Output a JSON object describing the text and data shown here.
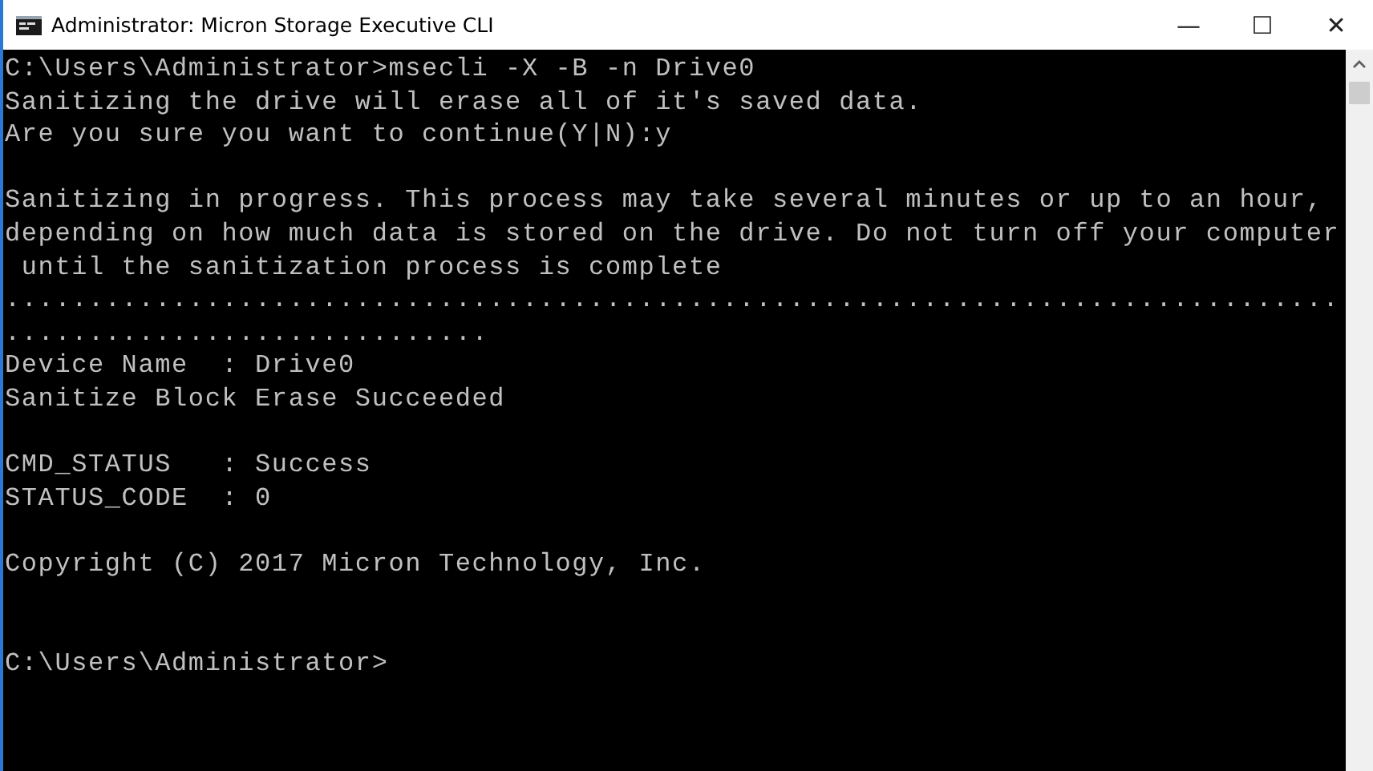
{
  "window": {
    "title": "Administrator: Micron Storage Executive CLI",
    "controls": [
      "—",
      "☐",
      "✕"
    ]
  },
  "console": {
    "lines": [
      {
        "kind": "text",
        "text": "C:\\Users\\Administrator>msecli -X -B -n Drive0"
      },
      {
        "kind": "text",
        "text": "Sanitizing the drive will erase all of it's saved data."
      },
      {
        "kind": "text",
        "text": "Are you sure you want to continue(Y|N):y"
      },
      {
        "kind": "blank"
      },
      {
        "kind": "text",
        "text": "Sanitizing in progress. This process may take several minutes or up to an hour,"
      },
      {
        "kind": "text",
        "text": "depending on how much data is stored on the drive. Do not turn off your computer"
      },
      {
        "kind": "text",
        "text": " until the sanitization process is complete"
      },
      {
        "kind": "text",
        "text": "................................................................................"
      },
      {
        "kind": "text",
        "text": "............................."
      },
      {
        "kind": "text",
        "text": "Device Name  : Drive0"
      },
      {
        "kind": "text",
        "text": "Sanitize Block Erase Succeeded"
      },
      {
        "kind": "blank"
      },
      {
        "kind": "text",
        "text": "CMD_STATUS   : Success"
      },
      {
        "kind": "text",
        "text": "STATUS_CODE  : 0"
      },
      {
        "kind": "blank"
      },
      {
        "kind": "text",
        "text": "Copyright (C) 2017 Micron Technology, Inc."
      },
      {
        "kind": "blank"
      },
      {
        "kind": "blank"
      },
      {
        "kind": "text",
        "text": "C:\\Users\\Administrator>"
      }
    ]
  }
}
